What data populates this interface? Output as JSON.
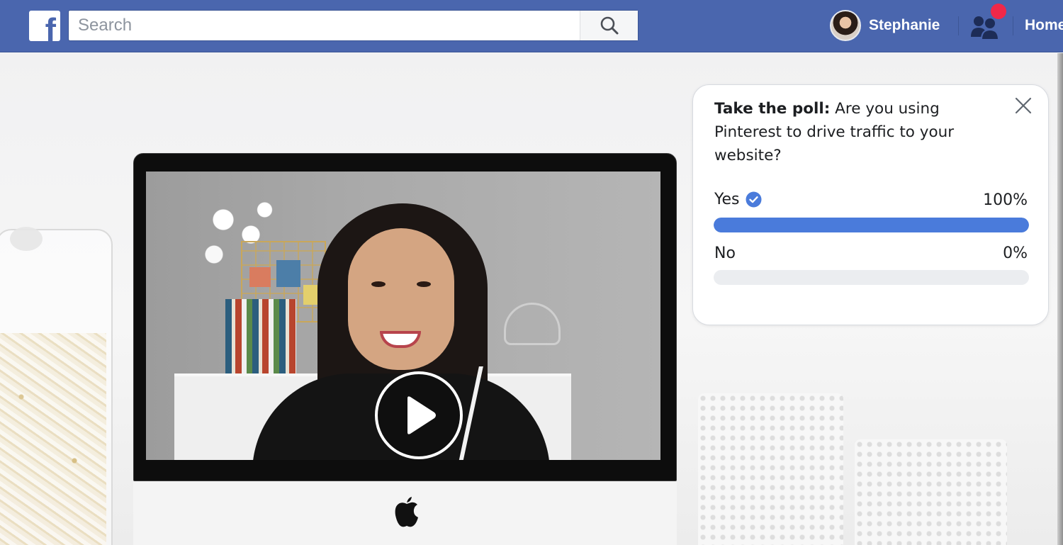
{
  "header": {
    "logo_letter": "f",
    "search": {
      "placeholder": "Search",
      "value": ""
    },
    "user_name": "Stephanie",
    "home_label": "Home",
    "brand_color": "#4a66ae",
    "notification_color": "#f02849"
  },
  "video": {
    "state": "paused",
    "play_icon": "play-icon",
    "device_logo": "apple-logo-icon"
  },
  "poll": {
    "prefix": "Take the poll:",
    "question": " Are you using Pinterest to drive traffic to your website?",
    "close_icon": "close-icon",
    "bar_color": "#4a7bdb",
    "options": [
      {
        "label": "Yes",
        "percent_label": "100%",
        "fraction": 1.0,
        "selected": true
      },
      {
        "label": "No",
        "percent_label": "0%",
        "fraction": 0.0,
        "selected": false
      }
    ]
  }
}
